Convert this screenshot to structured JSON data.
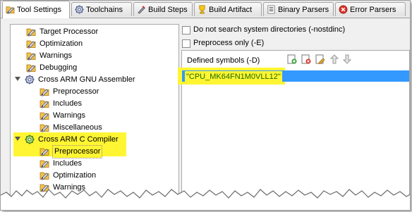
{
  "tabs": [
    {
      "label": "Tool Settings",
      "icon": "tool-settings-icon",
      "active": true
    },
    {
      "label": "Toolchains",
      "icon": "toolchains-icon"
    },
    {
      "label": "Build Steps",
      "icon": "build-steps-icon"
    },
    {
      "label": "Build Artifact",
      "icon": "build-artifact-icon"
    },
    {
      "label": "Binary Parsers",
      "icon": "binary-parsers-icon"
    },
    {
      "label": "Error Parsers",
      "icon": "error-parsers-icon"
    }
  ],
  "tree": {
    "target_processor": "Target Processor",
    "optimization": "Optimization",
    "warnings": "Warnings",
    "debugging": "Debugging",
    "assembler": "Cross ARM GNU Assembler",
    "asm_preprocessor": "Preprocessor",
    "asm_includes": "Includes",
    "asm_warnings": "Warnings",
    "asm_misc": "Miscellaneous",
    "c_compiler": "Cross ARM C Compiler",
    "c_preprocessor": "Preprocessor",
    "c_includes": "Includes",
    "c_optimization": "Optimization",
    "c_warnings": "Warnings"
  },
  "options": {
    "nostdinc": "Do not search system directories (-nostdinc)",
    "preprocess_only": "Preprocess only (-E)"
  },
  "defined_symbols": {
    "label": "Defined symbols (-D)",
    "value": "\"CPU_MK64FN1M0VLL12\""
  },
  "colors": {
    "highlight": "#fff533",
    "selection": "#3399ff"
  }
}
